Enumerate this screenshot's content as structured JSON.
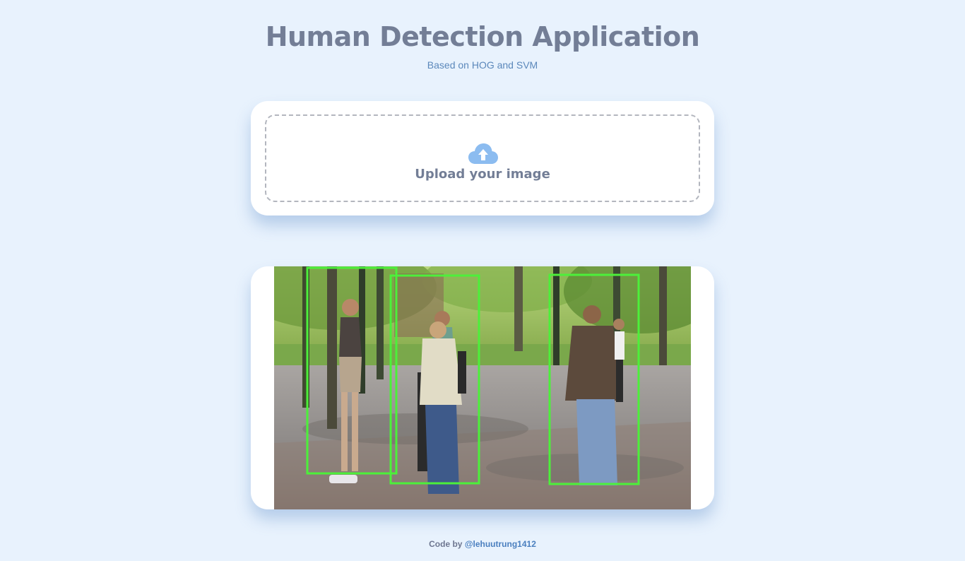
{
  "header": {
    "title": "Human Detection Application",
    "subtitle": "Based on HOG and SVM"
  },
  "upload": {
    "label": "Upload your image",
    "icon": "cloud-upload-icon"
  },
  "result": {
    "image": "detection-result-image",
    "detection_box_color": "#4cf03a",
    "detections": 3
  },
  "footer": {
    "prefix": "Code by",
    "author": "@lehuutrung1412"
  },
  "colors": {
    "background": "#e8f2fd",
    "title": "#737e96",
    "accent": "#5b88bb",
    "icon": "#8cbcf0"
  }
}
